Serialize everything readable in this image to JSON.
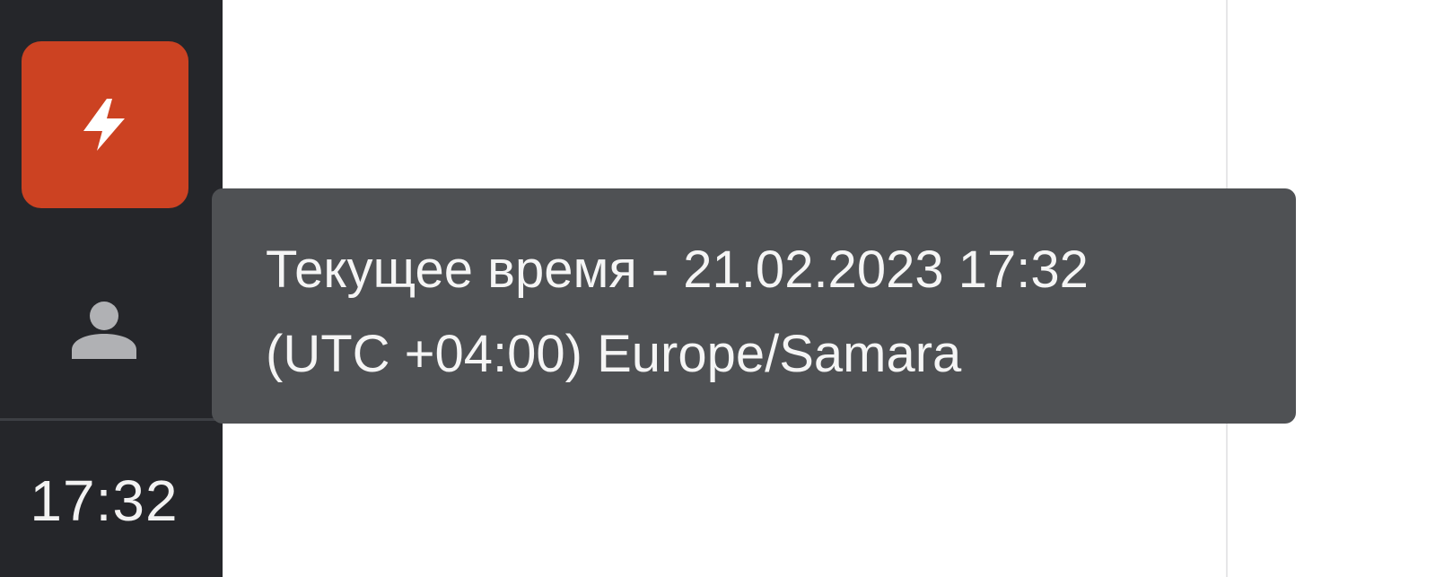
{
  "sidebar": {
    "app_button": {
      "icon": "lightning-bolt-icon",
      "color": "#cc4222"
    },
    "profile_button": {
      "icon": "user-icon"
    },
    "clock": "17:32"
  },
  "tooltip": {
    "line1": "Текущее время - 21.02.2023 17:32",
    "line2": "(UTC +04:00) Europe/Samara"
  },
  "colors": {
    "sidebar_bg": "#25262a",
    "tooltip_bg": "#4f5154",
    "accent": "#cc4222",
    "icon_gray": "#b0b1b4"
  }
}
